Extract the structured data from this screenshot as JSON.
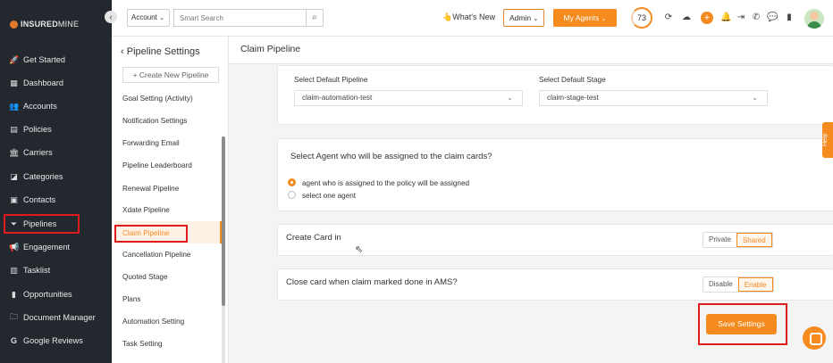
{
  "brand": {
    "name_bold": "INSURED",
    "name_thin": "MINE",
    "accent": "#f58a1f"
  },
  "sidebar": {
    "items": [
      {
        "label": "Get Started",
        "icon": "rocket-icon"
      },
      {
        "label": "Dashboard",
        "icon": "dashboard-icon"
      },
      {
        "label": "Accounts",
        "icon": "users-icon"
      },
      {
        "label": "Policies",
        "icon": "policy-icon"
      },
      {
        "label": "Carriers",
        "icon": "bank-icon"
      },
      {
        "label": "Categories",
        "icon": "category-icon"
      },
      {
        "label": "Contacts",
        "icon": "contacts-icon"
      },
      {
        "label": "Pipelines",
        "icon": "filter-icon",
        "active": true
      },
      {
        "label": "Engagement",
        "icon": "megaphone-icon"
      },
      {
        "label": "Tasklist",
        "icon": "tasklist-icon"
      },
      {
        "label": "Opportunities",
        "icon": "bars-icon"
      },
      {
        "label": "Document Manager",
        "icon": "folder-icon"
      },
      {
        "label": "Google Reviews",
        "icon": "google-icon"
      }
    ]
  },
  "topbar": {
    "account_select": "Account",
    "search_placeholder": "Smart Search",
    "whats_new": "What's New",
    "role_select": "Admin",
    "my_agents": "My Agents",
    "score": "73"
  },
  "subnav": {
    "title": "Pipeline Settings",
    "create_button": "Create New Pipeline",
    "items": [
      "Goal Setting (Activity)",
      "Notification Settings",
      "Forwarding Email",
      "Pipeline Leaderboard",
      "Renewal Pipeline",
      "Xdate Pipeline",
      "Claim Pipeline",
      "Cancellation Pipeline",
      "Quoted Stage",
      "Plans",
      "Automation Setting",
      "Task Setting"
    ],
    "active": "Claim Pipeline"
  },
  "main": {
    "title": "Claim Pipeline",
    "default_pipeline_label": "Select Default Pipeline",
    "default_pipeline_value": "claim-automation-test",
    "default_stage_label": "Select Default Stage",
    "default_stage_value": "claim-stage-test",
    "agent_question": "Select Agent who will be assigned to the claim cards?",
    "agent_options": [
      "agent who is assigned to the policy will be assigned",
      "select one agent"
    ],
    "agent_selected": 0,
    "create_card_label": "Create Card in",
    "create_card_options": [
      "Private",
      "Shared"
    ],
    "create_card_selected": "Shared",
    "close_card_label": "Close card when claim marked done in AMS?",
    "close_card_options": [
      "Disable",
      "Enable"
    ],
    "close_card_selected": "Enable",
    "save_button": "Save Settings"
  },
  "help_tab": "Help"
}
